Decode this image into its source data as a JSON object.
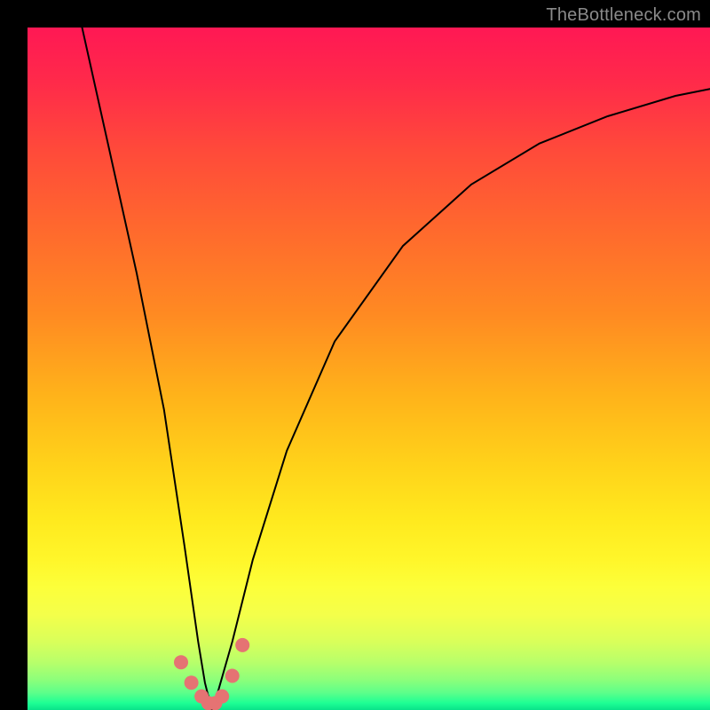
{
  "watermark": "TheBottleneck.com",
  "chart_data": {
    "type": "line",
    "title": "",
    "xlabel": "",
    "ylabel": "",
    "xlim": [
      0,
      100
    ],
    "ylim": [
      0,
      100
    ],
    "grid": false,
    "legend": false,
    "note": "Axes are unlabeled in the image; x/y values are normalized to 0–100 from plot-area pixel positions. The curve is a V-shape with its minimum near x≈27, y≈0.",
    "series": [
      {
        "name": "main-curve",
        "color": "#000000",
        "x": [
          8,
          12,
          16,
          20,
          23,
          25,
          26,
          27,
          28,
          30,
          33,
          38,
          45,
          55,
          65,
          75,
          85,
          95,
          100
        ],
        "y": [
          100,
          82,
          64,
          44,
          24,
          10,
          4,
          0,
          3,
          10,
          22,
          38,
          54,
          68,
          77,
          83,
          87,
          90,
          91
        ]
      }
    ],
    "markers": {
      "name": "valley-highlight-dots",
      "color": "#e57373",
      "radius_px": 8,
      "x": [
        22.5,
        24.0,
        25.5,
        26.5,
        27.5,
        28.5,
        30.0,
        31.5
      ],
      "y": [
        7.0,
        4.0,
        2.0,
        1.0,
        1.0,
        2.0,
        5.0,
        9.5
      ]
    },
    "background_gradient": {
      "direction": "vertical",
      "stops": [
        {
          "pos": 0.0,
          "color": "#ff1854"
        },
        {
          "pos": 0.3,
          "color": "#ff6a2d"
        },
        {
          "pos": 0.64,
          "color": "#ffd21a"
        },
        {
          "pos": 0.82,
          "color": "#fcff3a"
        },
        {
          "pos": 0.95,
          "color": "#8eff7a"
        },
        {
          "pos": 1.0,
          "color": "#08e28a"
        }
      ]
    }
  }
}
